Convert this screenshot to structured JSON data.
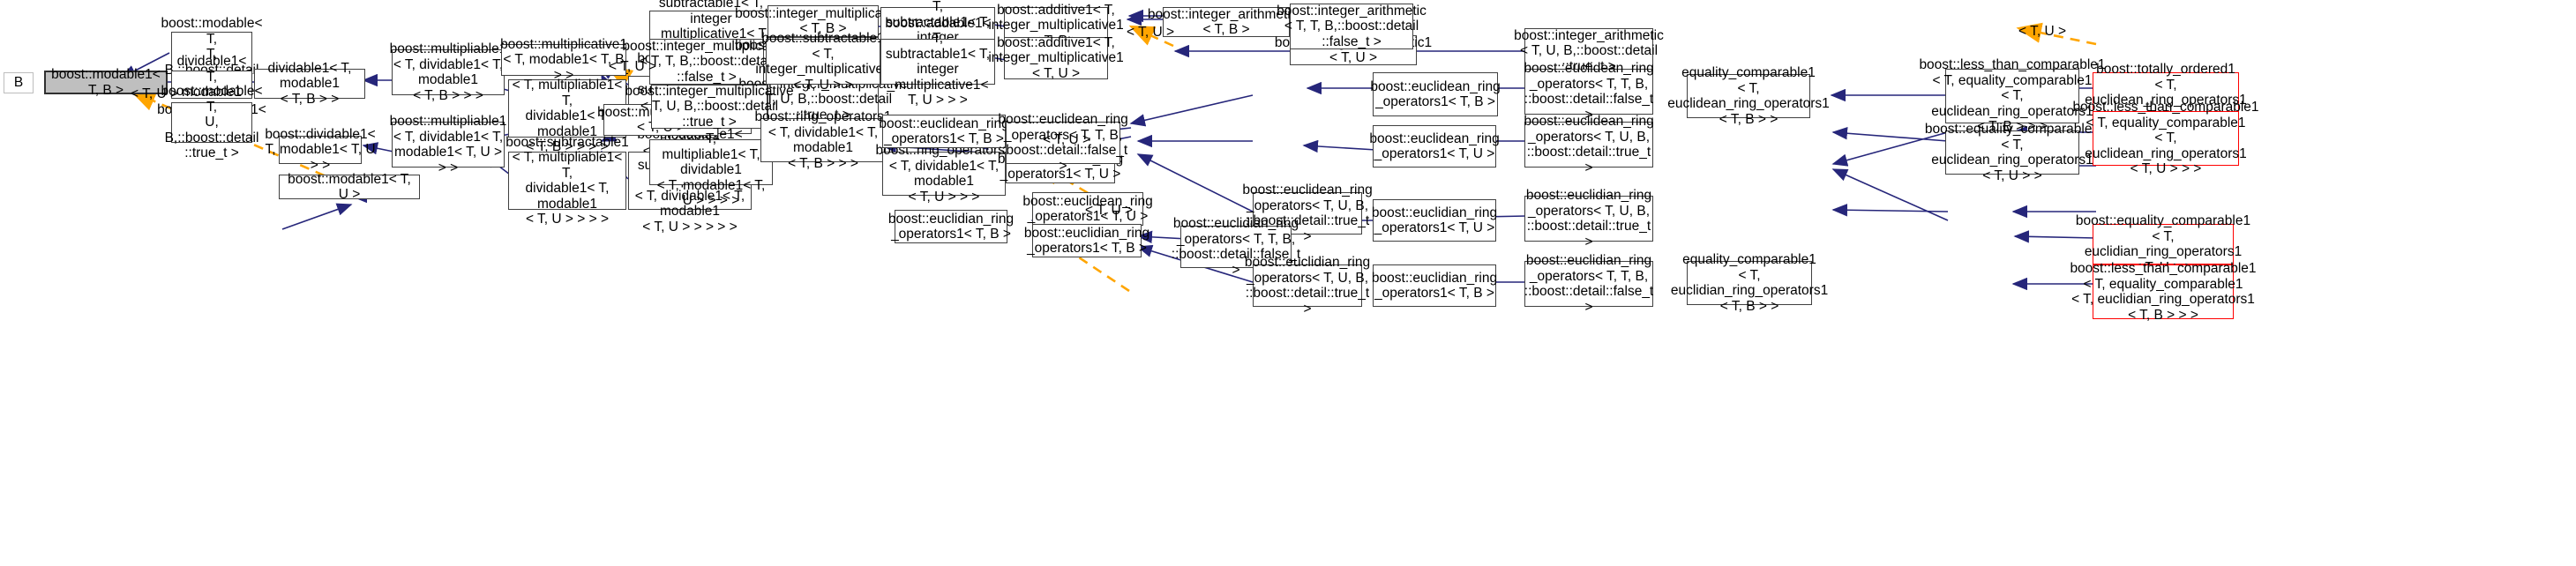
{
  "diagram": {
    "kind": "class-inheritance-graph",
    "root": "boost::modable1< T, B >",
    "colors": {
      "solid_edge": "#26267a",
      "dashed_edge": "#ffa500",
      "node_border": "#404040",
      "highlight_border": "#ff0000",
      "root_fill": "#bfbfbf",
      "node_fill": "#ffffff"
    },
    "edge_labels": [
      {
        "id": "lbl1",
        "text": "< T, U >"
      },
      {
        "id": "lbl2",
        "text": "< T, U >"
      },
      {
        "id": "lbl3",
        "text": "< T, U >"
      },
      {
        "id": "lbl4",
        "text": "< T, U >"
      },
      {
        "id": "lbl5",
        "text": "< T, U >"
      },
      {
        "id": "lbl6",
        "text": "< T, U >"
      }
    ],
    "nodes": [
      {
        "id": "n_B",
        "label": "B"
      },
      {
        "id": "n_root",
        "label": "boost::modable1< T, B >"
      },
      {
        "id": "n_mod_TTB_f",
        "label": "boost::modable< T,\nT, B,::boost::detail\n::false_t >"
      },
      {
        "id": "n_div1_mod1_B",
        "label": "dividable1< T, modable1\n< T, B > >"
      },
      {
        "id": "n_mod1_TU",
        "label": "boost::modable1< T, U >"
      },
      {
        "id": "n_mod_TUB_t",
        "label": "boost::modable< T,\nU, B,::boost::detail\n::true_t >"
      },
      {
        "id": "n_div1_TU",
        "label": "boost::dividable1<\nT, modable1< T, U > >"
      },
      {
        "id": "n_mul1_B",
        "label": "boost::multipliable1\n< T, dividable1< T, modable1\n< T, B > > >"
      },
      {
        "id": "n_mul1_TU",
        "label": "boost::multipliable1\n< T, dividable1< T,\nmodable1< T, U > > >"
      },
      {
        "id": "n_sub1_B",
        "label": "boost::subtractable1\n< T, multipliable1< T,\ndividable1< T, modable1\n< T, B > > > >"
      },
      {
        "id": "n_sub1_TU",
        "label": "boost::subtractable1\n< T, multipliable1< T,\ndividable1< T, modable1\n< T, U > > > >"
      },
      {
        "id": "n_mulcat1_B",
        "label": "boost::multiplicative1\n< T, modable1< T, B > >"
      },
      {
        "id": "n_add1_sub1_B",
        "label": "boost::addable1< T,\nsubtractable1< T, multipliable1\n< T, dividable1< T, modable1\n< T, B > > > > >"
      },
      {
        "id": "n_add1_sub1_TU",
        "label": "boost::addable1< T,\nsubtractable1< T, multipliable1\n< T, dividable1< T, modable1\n< T, U > > > > >"
      },
      {
        "id": "n_mulcat1_TU",
        "label": "boost::multiplicative1\n< T, U >"
      },
      {
        "id": "n_add1_div1_B",
        "label": "boost::additive1< T,\nmultipliable1< T, dividable1\n< T, modable1< T, B > > > >"
      },
      {
        "id": "n_add1_div1_TU",
        "label": "boost::additive1< T,\nmultipliable1< T, dividable1\n< T, modable1< T, U > > > >"
      },
      {
        "id": "n_sub1_int_B",
        "label": "subtractable1< T, integer\n_multiplicative1< T, B > >"
      },
      {
        "id": "n_int_mul_TTB_f",
        "label": "boost::integer_multiplicative\n< T, T, B,::boost::detail\n::false_t >"
      },
      {
        "id": "n_int_mul1_B",
        "label": "boost::integer_multiplicative1\n< T, B >"
      },
      {
        "id": "n_int_mul_TUB_t",
        "label": "boost::integer_multiplicative\n< T, U, B,::boost::detail\n::true_t >"
      },
      {
        "id": "n_int_mul1_TU",
        "label": "boost::integer_multiplicative1\n< T, U >"
      },
      {
        "id": "n_sub1_int_TU",
        "label": "boost::subtractable1\n< T, integer_multiplicative1\n< T, U > >"
      },
      {
        "id": "n_add1_sub_B",
        "label": "boost::addable1< T,\nsubtractable1< T, integer\n_multiplicative1< T, B > > >"
      },
      {
        "id": "n_add1_sub_TU",
        "label": "boost::addable1< T,\nsubtractable1< T, integer\n_multiplicative1< T, U > > >"
      },
      {
        "id": "n_add1_int_B",
        "label": "boost::additive1< T,\ninteger_multiplicative1\n< T, B >"
      },
      {
        "id": "n_add1_int_TU",
        "label": "boost::additive1< T,\ninteger_multiplicative1\n< T, U >"
      },
      {
        "id": "n_int_arith1_B",
        "label": "boost::integer_arithmetic1\n< T, B >"
      },
      {
        "id": "n_int_arith1_TU",
        "label": "boost::integer_arithmetic1\n< T, U >"
      },
      {
        "id": "n_int_arith_TTB_f",
        "label": "boost::integer_arithmetic\n< T, T, B,::boost::detail\n::false_t >"
      },
      {
        "id": "n_int_arith_TUB_t",
        "label": "boost::integer_arithmetic\n< T, U, B,::boost::detail\n::true_t >"
      },
      {
        "id": "n_ring_ops1_B",
        "label": "boost::ring_operators1\n< T, dividable1< T, modable1\n< T, B > > >"
      },
      {
        "id": "n_ring_ops1_TU",
        "label": "boost::ring_operators1\n< T, dividable1< T, modable1\n< T, U > > >"
      },
      {
        "id": "n_eucl_ops1_B",
        "label": "boost::euclidean_ring\n_operators1< T, B >"
      },
      {
        "id": "n_eucl_ops1_TU",
        "label": "boost::euclidean_ring\n_operators1< T, U >"
      },
      {
        "id": "n_euclid_ops1_B",
        "label": "boost::euclidian_ring\n_operators1< T, B >"
      },
      {
        "id": "n_euclid_ops1_TU",
        "label": "boost::euclidian_ring\n_operators1< T, U >"
      },
      {
        "id": "n_eucl_ops_TTB_f",
        "label": "boost::euclidean_ring\n_operators< T, T, B,\n::boost::detail::false_t >"
      },
      {
        "id": "n_eucl_ops_TUB_t",
        "label": "boost::euclidean_ring\n_operators< T, U, B,\n::boost::detail::true_t >"
      },
      {
        "id": "n_euclid_ops_TTB_f",
        "label": "boost::euclidian_ring\n_operators< T, T, B,\n::boost::detail::false_t >"
      },
      {
        "id": "n_euclid_ops_TUB_t",
        "label": "boost::euclidian_ring\n_operators< T, U, B,\n::boost::detail::true_t >"
      },
      {
        "id": "n_eq_cmp1_B",
        "label": "equality_comparable1\n< T, euclidean_ring_operators1\n< T, B > >"
      },
      {
        "id": "n_eq_cmp1_B2",
        "label": "equality_comparable1\n< T, euclidian_ring_operators1\n< T, B > >"
      },
      {
        "id": "n_lt_cmp1_B",
        "label": "boost::less_than_comparable1\n< T, equality_comparable1\n< T, euclidean_ring_operators1\n< T, B > > >"
      },
      {
        "id": "n_eq_cmp1_TU",
        "label": "boost::equality_comparable1\n< T, euclidean_ring_operators1\n< T, U > >"
      },
      {
        "id": "n_tot_ord1_B",
        "label": "boost::totally_ordered1\n< T, euclidean_ring_operators1\n< T, B > >"
      },
      {
        "id": "n_lt_cmp1_TU",
        "label": "boost::less_than_comparable1\n< T, equality_comparable1\n< T, euclidean_ring_operators1\n< T, U > > >"
      },
      {
        "id": "n_eq_cmp1_TU_2",
        "label": "boost::equality_comparable1\n< T, euclidian_ring_operators1\n< T, U > >"
      },
      {
        "id": "n_lt_cmp1_TU_2",
        "label": "boost::less_than_comparable1\n< T, equality_comparable1\n< T, euclidian_ring_operators1\n< T, B > > >"
      }
    ]
  }
}
